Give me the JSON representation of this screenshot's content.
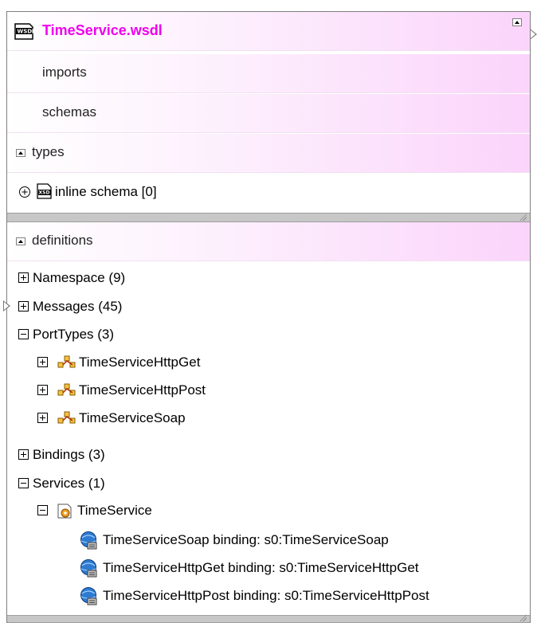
{
  "header": {
    "title": "TimeService.wsdl"
  },
  "top_panel": {
    "imports_label": "imports",
    "schemas_label": "schemas",
    "types_label": "types",
    "inline_schema_label": "inline schema [0]"
  },
  "definitions": {
    "label": "definitions",
    "namespace": "Namespace (9)",
    "messages": "Messages (45)",
    "porttypes": "PortTypes (3)",
    "porttype_items": [
      "TimeServiceHttpGet",
      "TimeServiceHttpPost",
      "TimeServiceSoap"
    ],
    "bindings": "Bindings (3)",
    "services": "Services (1)",
    "service_name": "TimeService",
    "ports": [
      "TimeServiceSoap  binding: s0:TimeServiceSoap",
      "TimeServiceHttpGet  binding: s0:TimeServiceHttpGet",
      "TimeServiceHttpPost  binding: s0:TimeServiceHttpPost"
    ]
  },
  "colors": {
    "title": "#ee00ee",
    "header_gradient": "#fbd4fb",
    "splitter": "#c7c7c7"
  },
  "icons": [
    "wsdl-file-icon",
    "xsd-file-icon",
    "porttype-icon",
    "service-icon",
    "port-globe-icon"
  ]
}
